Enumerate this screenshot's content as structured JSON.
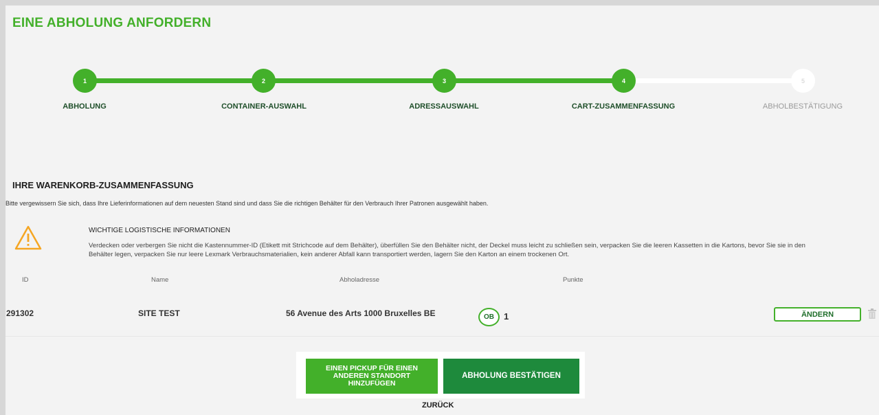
{
  "page": {
    "title": "EINE ABHOLUNG ANFORDERN"
  },
  "stepper": {
    "steps": [
      {
        "number": "1",
        "label": "ABHOLUNG",
        "state": "done"
      },
      {
        "number": "2",
        "label": "CONTAINER-AUSWAHL",
        "state": "done"
      },
      {
        "number": "3",
        "label": "ADRESSAUSWAHL",
        "state": "done"
      },
      {
        "number": "4",
        "label": "CART-ZUSAMMENFASSUNG",
        "state": "current"
      },
      {
        "number": "5",
        "label": "ABHOLBESTÄTIGUNG",
        "state": "todo"
      }
    ]
  },
  "summary": {
    "title": "IHRE WARENKORB-ZUSAMMENFASSUNG",
    "text": "Bitte vergewissern Sie sich, dass Ihre Lieferinformationen auf dem neuesten Stand sind und dass Sie die richtigen Behälter für den Verbrauch Ihrer Patronen ausgewählt haben."
  },
  "logistics": {
    "icon": "warning-triangle-icon",
    "heading": "WICHTIGE LOGISTISCHE INFORMATIONEN",
    "text": "Verdecken oder verbergen Sie nicht die Kastennummer-ID (Etikett mit Strichcode auf dem Behälter), überfüllen Sie den Behälter nicht, der Deckel muss leicht zu schließen sein, verpacken Sie die leeren Kassetten in die Kartons, bevor Sie sie in den Behälter legen, verpacken Sie nur leere Lexmark Verbrauchsmaterialien, kein anderer Abfall kann transportiert werden, lagern Sie den Karton an einem trockenen Ort."
  },
  "table": {
    "headers": {
      "id": "ID",
      "name": "Name",
      "address": "Abholadresse",
      "points": "Punkte"
    },
    "rows": [
      {
        "id": "291302",
        "name": "SITE TEST",
        "address": "56 Avenue des Arts 1000 Bruxelles BE",
        "badge": "OB",
        "points": "1",
        "edit_label": "ÄNDERN"
      }
    ]
  },
  "actions": {
    "add_pickup_label": "EINEN PICKUP FÜR EINEN ANDEREN STANDORT HINZUFÜGEN",
    "confirm_label": "ABHOLUNG BESTÄTIGEN",
    "back_label": "ZURÜCK"
  },
  "colors": {
    "brand_green": "#43b02a",
    "dark_green": "#1e8a3c",
    "warning": "#f5a623"
  }
}
